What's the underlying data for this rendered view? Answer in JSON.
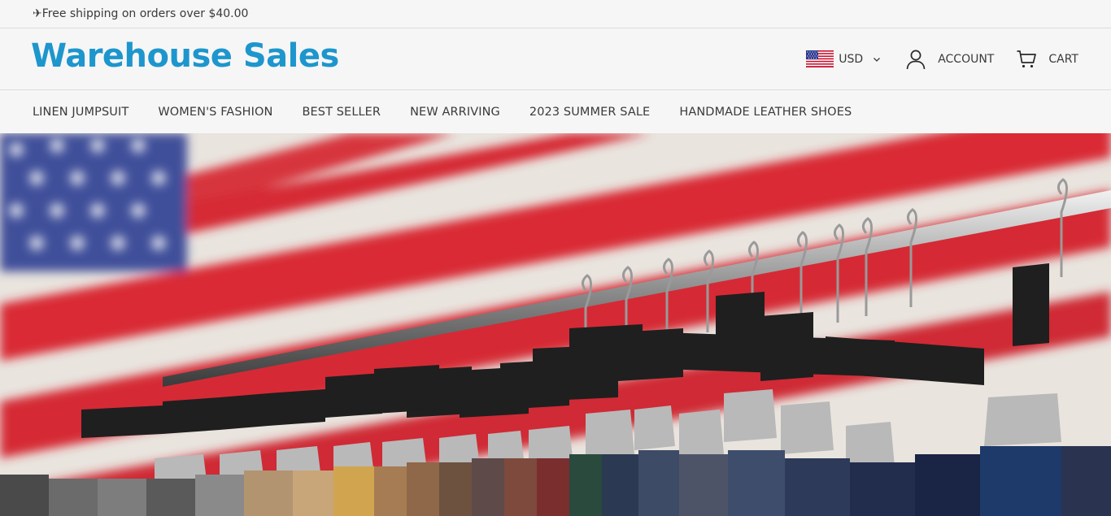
{
  "announcement": {
    "icon": "airplane-icon",
    "text": "✈Free shipping on orders over $40.00"
  },
  "header": {
    "logo": "Warehouse Sales",
    "currency": {
      "flag": "us-flag-icon",
      "label": "USD"
    },
    "account_label": "ACCOUNT",
    "cart_label": "CART"
  },
  "nav": {
    "items": [
      {
        "label": "LINEN JUMPSUIT"
      },
      {
        "label": "WOMEN'S FASHION"
      },
      {
        "label": "BEST SELLER"
      },
      {
        "label": "NEW ARRIVING"
      },
      {
        "label": "2023 SUMMER SALE"
      },
      {
        "label": "HANDMADE LEATHER SHOES"
      }
    ]
  },
  "colors": {
    "brand": "#1d96cd",
    "text": "#3a3a3a",
    "background": "#f6f6f6",
    "divider": "#dcdcdc"
  }
}
